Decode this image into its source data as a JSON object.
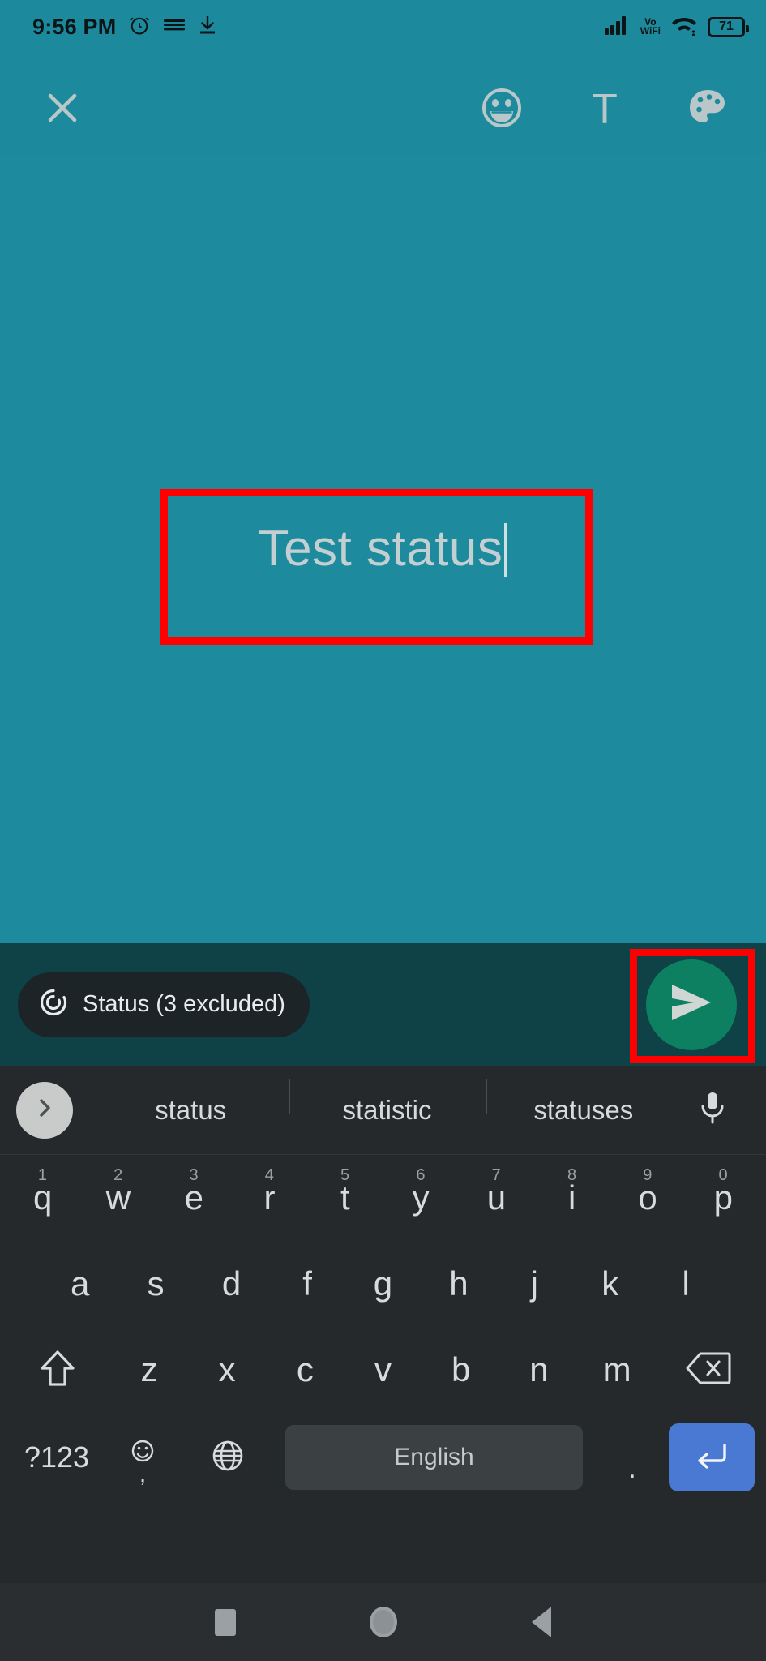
{
  "status_bar": {
    "time": "9:56 PM",
    "icons_left": [
      "alarm-icon",
      "keyboard-icon",
      "download-icon"
    ],
    "icons_right": [
      "cellular-signal-icon",
      "vowifi-icon",
      "wifi-icon",
      "battery-icon"
    ],
    "vowifi_line1": "Vo",
    "vowifi_line2": "WiFi",
    "battery_level": "71"
  },
  "toolbar": {
    "close_label": "close-icon",
    "emoji_label": "emoji-icon",
    "text_label": "T",
    "palette_label": "palette-icon"
  },
  "canvas": {
    "status_text": "Test status",
    "caret_visible": true,
    "background_color": "#1d8b9d"
  },
  "annotations": {
    "highlight_color": "#ff0000",
    "boxes": [
      "text-entry-highlight",
      "send-button-highlight"
    ]
  },
  "bottom_bar": {
    "privacy_chip_label": "Status (3 excluded)",
    "privacy_chip_icon": "status-ring-icon",
    "send_button_icon": "send-icon",
    "send_button_color": "#0e8062",
    "background_color": "#0e4247"
  },
  "keyboard": {
    "suggestions": [
      "status",
      "statistic",
      "statuses"
    ],
    "expand_icon": "chevron-right-icon",
    "mic_icon": "microphone-icon",
    "row1": [
      {
        "key": "q",
        "num": "1"
      },
      {
        "key": "w",
        "num": "2"
      },
      {
        "key": "e",
        "num": "3"
      },
      {
        "key": "r",
        "num": "4"
      },
      {
        "key": "t",
        "num": "5"
      },
      {
        "key": "y",
        "num": "6"
      },
      {
        "key": "u",
        "num": "7"
      },
      {
        "key": "i",
        "num": "8"
      },
      {
        "key": "o",
        "num": "9"
      },
      {
        "key": "p",
        "num": "0"
      }
    ],
    "row2": [
      "a",
      "s",
      "d",
      "f",
      "g",
      "h",
      "j",
      "k",
      "l"
    ],
    "row3": [
      "z",
      "x",
      "c",
      "v",
      "b",
      "n",
      "m"
    ],
    "shift_icon": "shift-up-arrow-icon",
    "backspace_icon": "backspace-icon",
    "symbols_label": "?123",
    "emoji_key_icon": "emoji-comma-icon",
    "emoji_key_comma": ",",
    "globe_icon": "language-globe-icon",
    "space_label": "English",
    "period_label": ".",
    "enter_icon": "enter-return-icon",
    "enter_color": "#4a79d4"
  },
  "nav_bar": {
    "recents_label": "recents-icon",
    "home_label": "home-icon",
    "back_label": "back-icon"
  }
}
